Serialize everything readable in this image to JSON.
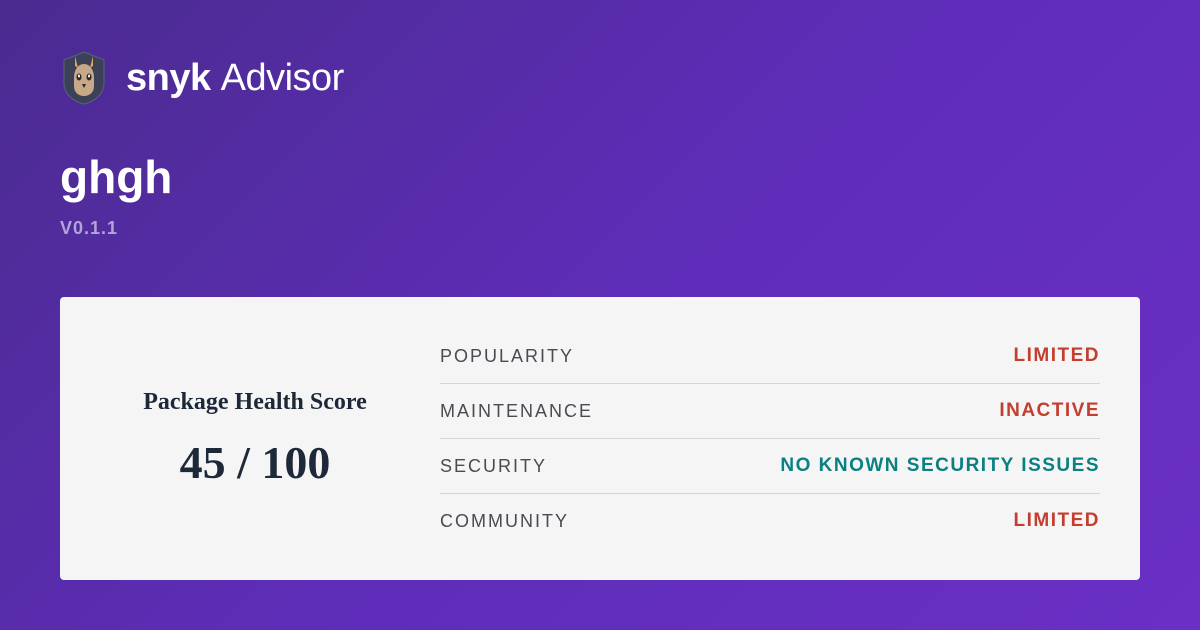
{
  "brand": {
    "name": "snyk",
    "product": "Advisor"
  },
  "package": {
    "name": "ghgh",
    "version": "V0.1.1"
  },
  "score": {
    "label": "Package Health Score",
    "value": "45 / 100"
  },
  "metrics": {
    "popularity": {
      "label": "POPULARITY",
      "value": "LIMITED",
      "status": "limited"
    },
    "maintenance": {
      "label": "MAINTENANCE",
      "value": "INACTIVE",
      "status": "inactive"
    },
    "security": {
      "label": "SECURITY",
      "value": "NO KNOWN SECURITY ISSUES",
      "status": "ok"
    },
    "community": {
      "label": "COMMUNITY",
      "value": "LIMITED",
      "status": "limited"
    }
  }
}
